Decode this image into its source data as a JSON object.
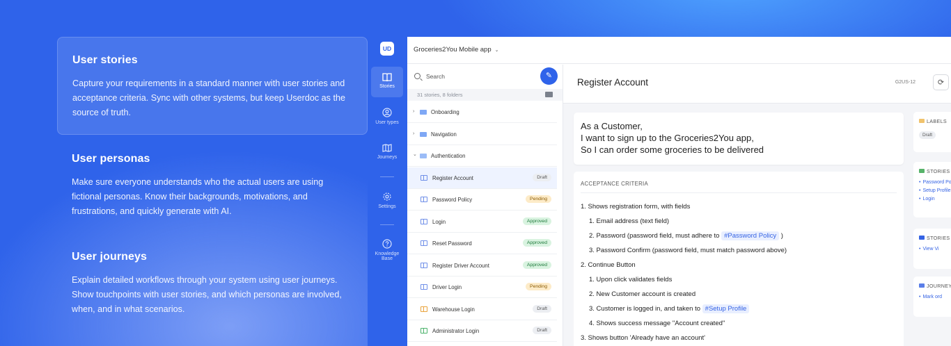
{
  "features": [
    {
      "title": "User stories",
      "body": "Capture your requirements in a standard manner with user stories and acceptance criteria. Sync with other systems, but keep Userdoc as the source of truth."
    },
    {
      "title": "User personas",
      "body": "Make sure everyone understands who the actual users are using fictional personas. Know their backgrounds, motivations, and frustrations, and quickly generate with AI."
    },
    {
      "title": "User journeys",
      "body": "Explain detailed workflows through your system using user journeys. Show touchpoints with user stories, and which personas are involved, when, and in what scenarios."
    }
  ],
  "app": {
    "logo": "UD",
    "project": "Groceries2You Mobile app",
    "rail": [
      {
        "label": "Stories",
        "icon": "book-icon"
      },
      {
        "label": "User types",
        "icon": "user-icon"
      },
      {
        "label": "Journeys",
        "icon": "map-icon"
      },
      {
        "label": "Settings",
        "icon": "gear-icon"
      },
      {
        "label": "Knowledge Base",
        "icon": "help-icon"
      }
    ],
    "tree": {
      "search_placeholder": "Search",
      "count": "31 stories, 8 folders",
      "folders": [
        {
          "label": "Onboarding",
          "arrow": "›"
        },
        {
          "label": "Navigation",
          "arrow": "›"
        },
        {
          "label": "Authentication",
          "arrow": "⌄"
        }
      ],
      "stories": [
        {
          "label": "Register Account",
          "status": "Draft"
        },
        {
          "label": "Password Policy",
          "status": "Pending"
        },
        {
          "label": "Login",
          "status": "Approved"
        },
        {
          "label": "Reset Password",
          "status": "Approved"
        },
        {
          "label": "Register Driver Account",
          "status": "Approved"
        },
        {
          "label": "Driver Login",
          "status": "Pending"
        },
        {
          "label": "Warehouse Login",
          "status": "Draft"
        },
        {
          "label": "Administrator Login",
          "status": "Draft"
        }
      ]
    },
    "detail": {
      "title": "Register Account",
      "code": "G2US-12",
      "story": [
        "As a Customer,",
        "I want to sign up to the Groceries2You app,",
        "So I can order some groceries to be delivered"
      ],
      "ac_header": "ACCEPTANCE CRITERIA",
      "ac": [
        "1. Shows registration form, with fields",
        "1. Email address (text field)",
        "2. Password (password field, must adhere to",
        "#Password Policy",
        ")",
        "3. Password Confirm (password field, must match password above)",
        "2. Continue Button",
        "1. Upon click validates fields",
        "2. New Customer account is created",
        "3. Customer is logged in, and taken to",
        "#Setup Profile",
        "4. Shows success message \"Account created\"",
        "3. Shows button 'Already have an account'"
      ],
      "side": {
        "labels_title": "LABELS",
        "labels_badge": "Draft",
        "stories_title": "STORIES",
        "stories_items": [
          "Password Policy",
          "Setup Profile",
          "Login"
        ],
        "stories2_title": "STORIES",
        "stories2_items": [
          "View Vi"
        ],
        "journeys_title": "JOURNEYS",
        "journeys_items": [
          "Mark ord"
        ]
      }
    }
  }
}
